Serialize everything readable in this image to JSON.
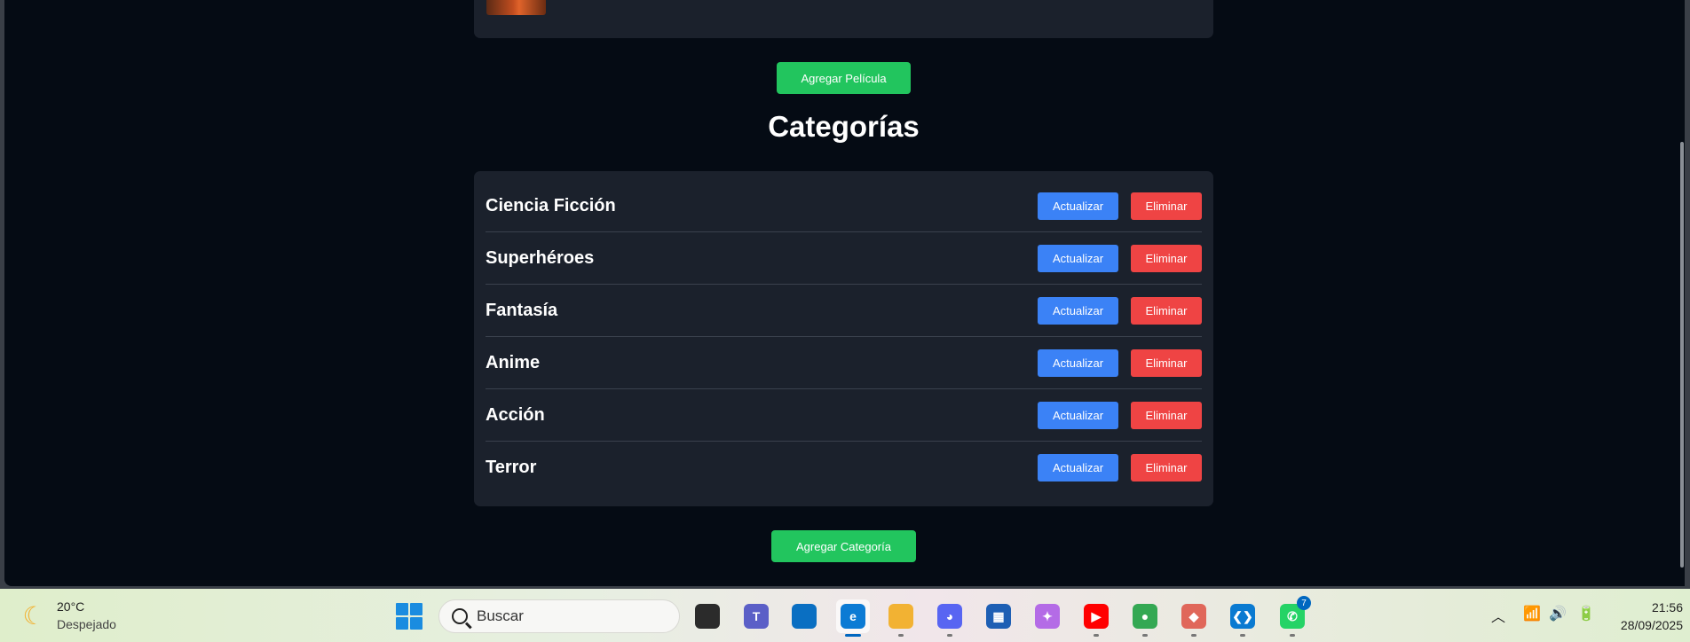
{
  "movies_section": {
    "add_movie_label": "Agregar Película"
  },
  "categories_section": {
    "title": "Categorías",
    "update_label": "Actualizar",
    "delete_label": "Eliminar",
    "items": [
      {
        "name": "Ciencia Ficción"
      },
      {
        "name": "Superhéroes"
      },
      {
        "name": "Fantasía"
      },
      {
        "name": "Anime"
      },
      {
        "name": "Acción"
      },
      {
        "name": "Terror"
      }
    ],
    "add_category_label": "Agregar Categoría"
  },
  "taskbar": {
    "weather": {
      "temp": "20°C",
      "condition": "Despejado",
      "icon": "moon-icon"
    },
    "search_placeholder": "Buscar",
    "apps": [
      {
        "name": "task-view",
        "glyph": "",
        "color": "#2b2b2b"
      },
      {
        "name": "teams",
        "glyph": "T",
        "color": "#5b5fc7"
      },
      {
        "name": "widgets-app",
        "glyph": "",
        "color": "#0a6fc2"
      },
      {
        "name": "edge",
        "glyph": "e",
        "color": "#0c7bd4"
      },
      {
        "name": "file-explorer",
        "glyph": "",
        "color": "#f2b233"
      },
      {
        "name": "discord",
        "glyph": "◕",
        "color": "#5865f2"
      },
      {
        "name": "microsoft-store",
        "glyph": "▦",
        "color": "#1e5fb4"
      },
      {
        "name": "copilot",
        "glyph": "✦",
        "color": "#b46be6"
      },
      {
        "name": "youtube",
        "glyph": "▶",
        "color": "#ff0000"
      },
      {
        "name": "chrome",
        "glyph": "●",
        "color": "#34a853"
      },
      {
        "name": "git-app",
        "glyph": "◆",
        "color": "#e0675a"
      },
      {
        "name": "vscode",
        "glyph": "❮❯",
        "color": "#0a7ad1"
      },
      {
        "name": "whatsapp",
        "glyph": "✆",
        "color": "#25d366",
        "badge": "7"
      }
    ],
    "clock": {
      "time": "21:56",
      "date": "28/09/2025"
    }
  }
}
